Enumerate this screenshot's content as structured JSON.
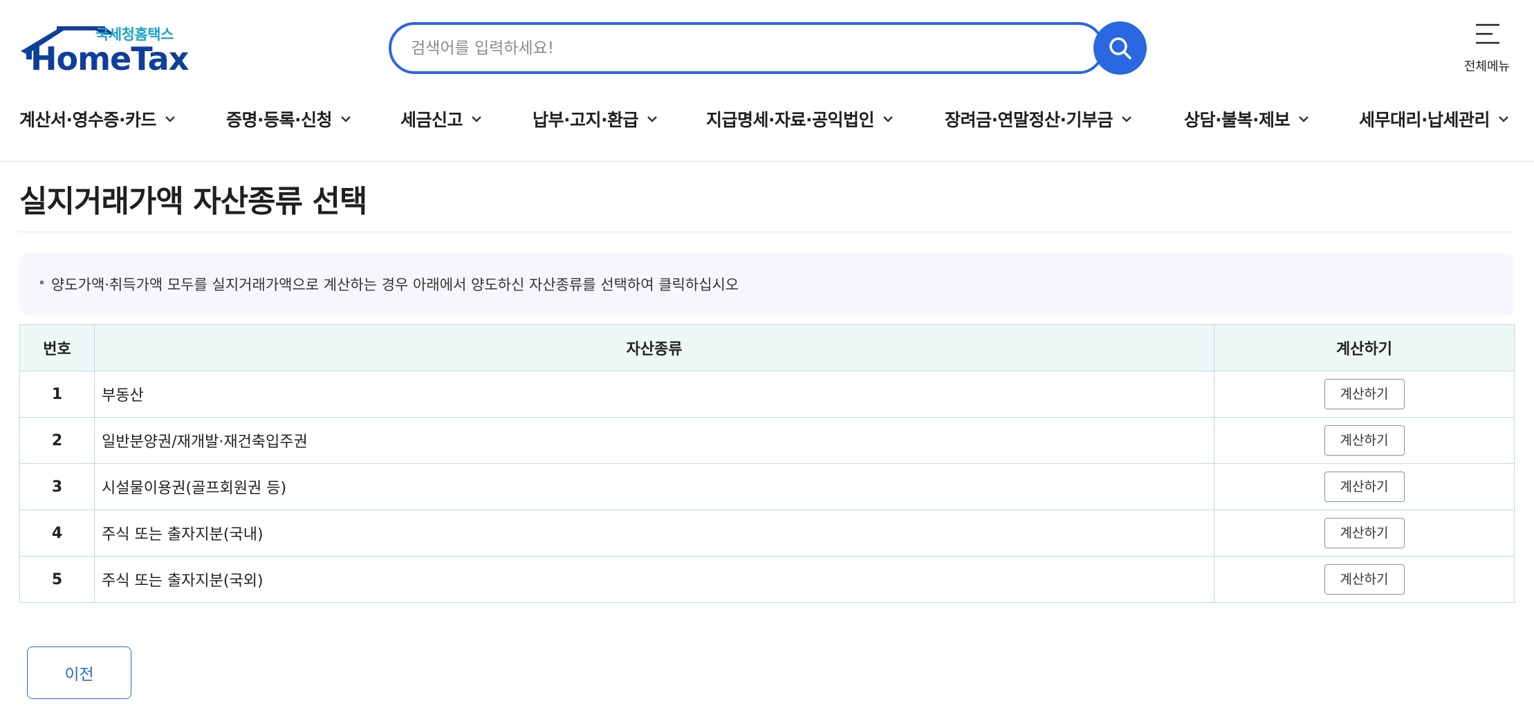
{
  "header": {
    "logo_sub": "국세청홈택스",
    "logo_main": "HomeTax",
    "search_placeholder": "검색어를 입력하세요!",
    "menu_label": "전체메뉴"
  },
  "nav": {
    "items": [
      "계산서·영수증·카드",
      "증명·등록·신청",
      "세금신고",
      "납부·고지·환급",
      "지급명세·자료·공익법인",
      "장려금·연말정산·기부금",
      "상담·불복·제보",
      "세무대리·납세관리"
    ]
  },
  "page": {
    "title": "실지거래가액 자산종류 선택",
    "notice": "양도가액·취득가액 모두를 실지거래가액으로 계산하는 경우 아래에서 양도하신 자산종류를 선택하여 클릭하십시오"
  },
  "table": {
    "headers": [
      "번호",
      "자산종류",
      "계산하기"
    ],
    "rows": [
      {
        "num": "1",
        "name": "부동산",
        "action": "계산하기"
      },
      {
        "num": "2",
        "name": "일반분양권/재개발·재건축입주권",
        "action": "계산하기"
      },
      {
        "num": "3",
        "name": "시설물이용권(골프회원권 등)",
        "action": "계산하기"
      },
      {
        "num": "4",
        "name": "주식 또는 출자지분(국내)",
        "action": "계산하기"
      },
      {
        "num": "5",
        "name": "주식 또는 출자지분(국외)",
        "action": "계산하기"
      }
    ]
  },
  "footer": {
    "prev_label": "이전"
  },
  "colors": {
    "accent": "#2a67e0",
    "logo_navy": "#0f3f9a",
    "logo_cyan": "#1ba3c4",
    "table_header_bg": "#eef8f6",
    "table_border": "#b9dbe0"
  }
}
